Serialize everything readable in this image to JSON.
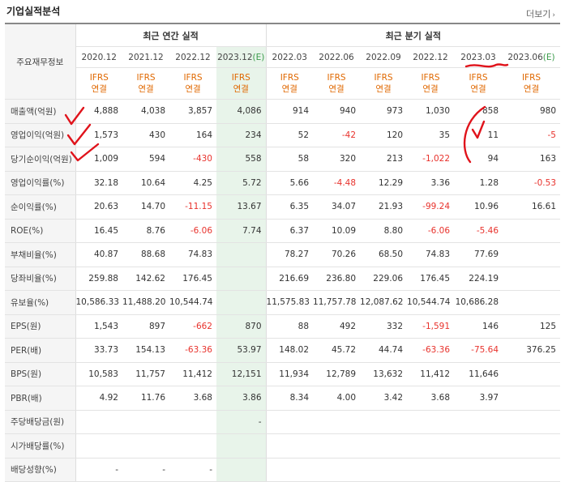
{
  "title": "기업실적분석",
  "more_label": "더보기",
  "category_header": "주요재무정보",
  "annual_group": "최근 연간 실적",
  "quarter_group": "최근 분기 실적",
  "annual_periods": [
    "2020.12",
    "2021.12",
    "2022.12",
    "2023.12"
  ],
  "annual_est_suffix": "(E)",
  "quarter_periods": [
    "2022.03",
    "2022.06",
    "2022.09",
    "2022.12",
    "2023.03",
    "2023.06"
  ],
  "quarter_est_suffix": "(E)",
  "acct_line1": "IFRS",
  "acct_line2": "연결",
  "rows": [
    {
      "label": "매출액(억원)",
      "values": [
        "4,888",
        "4,038",
        "3,857",
        "4,086",
        "914",
        "940",
        "973",
        "1,030",
        "858",
        "980"
      ]
    },
    {
      "label": "영업이익(억원)",
      "values": [
        "1,573",
        "430",
        "164",
        "234",
        "52",
        "-42",
        "120",
        "35",
        "11",
        "-5"
      ]
    },
    {
      "label": "당기순이익(억원)",
      "values": [
        "1,009",
        "594",
        "-430",
        "558",
        "58",
        "320",
        "213",
        "-1,022",
        "94",
        "163"
      ]
    },
    {
      "label": "영업이익률(%)",
      "values": [
        "32.18",
        "10.64",
        "4.25",
        "5.72",
        "5.66",
        "-4.48",
        "12.29",
        "3.36",
        "1.28",
        "-0.53"
      ]
    },
    {
      "label": "순이익률(%)",
      "values": [
        "20.63",
        "14.70",
        "-11.15",
        "13.67",
        "6.35",
        "34.07",
        "21.93",
        "-99.24",
        "10.96",
        "16.61"
      ]
    },
    {
      "label": "ROE(%)",
      "values": [
        "16.45",
        "8.76",
        "-6.06",
        "7.74",
        "6.37",
        "10.09",
        "8.80",
        "-6.06",
        "-5.46",
        ""
      ]
    },
    {
      "label": "부채비율(%)",
      "values": [
        "40.87",
        "88.68",
        "74.83",
        "",
        "78.27",
        "70.26",
        "68.50",
        "74.83",
        "77.69",
        ""
      ]
    },
    {
      "label": "당좌비율(%)",
      "values": [
        "259.88",
        "142.62",
        "176.45",
        "",
        "216.69",
        "236.80",
        "229.06",
        "176.45",
        "224.19",
        ""
      ]
    },
    {
      "label": "유보율(%)",
      "values": [
        "10,586.33",
        "11,488.20",
        "10,544.74",
        "",
        "11,575.83",
        "11,757.78",
        "12,087.62",
        "10,544.74",
        "10,686.28",
        ""
      ]
    },
    {
      "label": "EPS(원)",
      "values": [
        "1,543",
        "897",
        "-662",
        "870",
        "88",
        "492",
        "332",
        "-1,591",
        "146",
        "125"
      ]
    },
    {
      "label": "PER(배)",
      "values": [
        "33.73",
        "154.13",
        "-63.36",
        "53.97",
        "148.02",
        "45.72",
        "44.74",
        "-63.36",
        "-75.64",
        "376.25"
      ]
    },
    {
      "label": "BPS(원)",
      "values": [
        "10,583",
        "11,757",
        "11,412",
        "12,151",
        "11,934",
        "12,789",
        "13,632",
        "11,412",
        "11,646",
        ""
      ]
    },
    {
      "label": "PBR(배)",
      "values": [
        "4.92",
        "11.76",
        "3.68",
        "3.86",
        "8.34",
        "4.00",
        "3.42",
        "3.68",
        "3.97",
        ""
      ]
    },
    {
      "label": "주당배당금(원)",
      "values": [
        "",
        "",
        "",
        "-",
        "",
        "",
        "",
        "",
        "",
        ""
      ]
    },
    {
      "label": "시가배당률(%)",
      "values": [
        "",
        "",
        "",
        "",
        "",
        "",
        "",
        "",
        "",
        ""
      ]
    },
    {
      "label": "배당성향(%)",
      "values": [
        "-",
        "-",
        "-",
        "",
        "",
        "",
        "",
        "",
        "",
        ""
      ]
    }
  ],
  "colors": {
    "negative": "#e8322c",
    "account": "#e06800",
    "estimate_bg": "#eef7ef",
    "estimate_text": "#3a9a4a",
    "annotation": "#e0131b"
  }
}
